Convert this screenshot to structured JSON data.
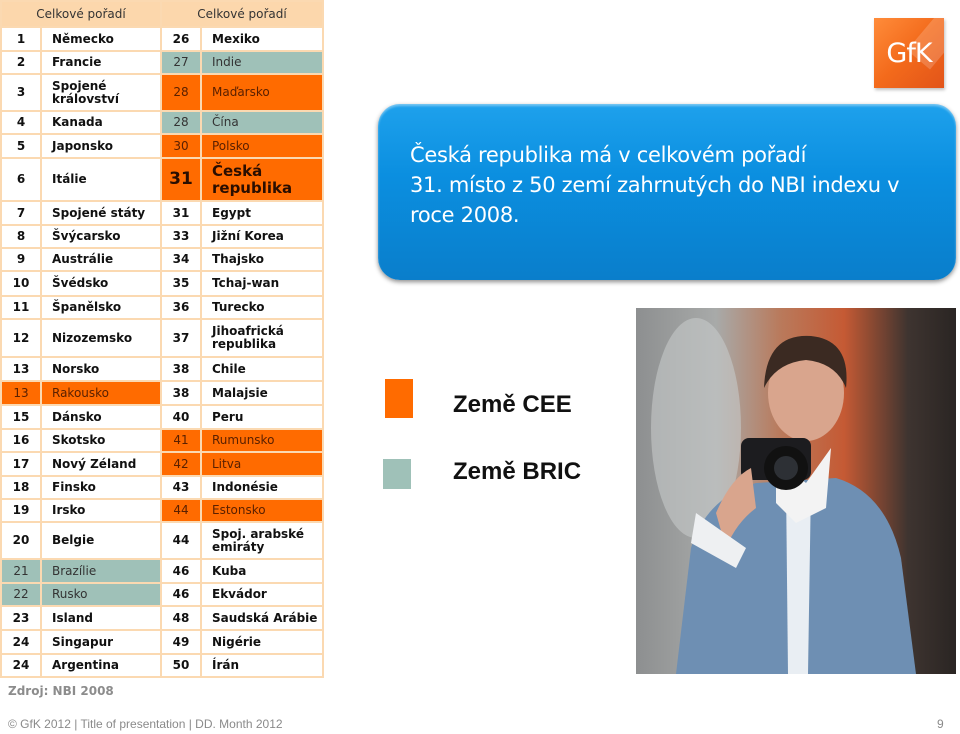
{
  "table": {
    "header_left": "Celkové pořadí",
    "header_right": "Celkové pořadí",
    "rows": [
      {
        "lr": "1",
        "ln": "Německo",
        "lc": "",
        "rr": "26",
        "rn": "Mexiko",
        "rc": ""
      },
      {
        "lr": "2",
        "ln": "Francie",
        "lc": "",
        "rr": "27",
        "rn": "Indie",
        "rc": "bric"
      },
      {
        "lr": "3",
        "ln": "Spojené království",
        "lc": "",
        "rr": "28",
        "rn": "Maďarsko",
        "rc": "cee"
      },
      {
        "lr": "4",
        "ln": "Kanada",
        "lc": "",
        "rr": "28",
        "rn": "Čína",
        "rc": "bric"
      },
      {
        "lr": "5",
        "ln": "Japonsko",
        "lc": "",
        "rr": "30",
        "rn": "Polsko",
        "rc": "cee"
      },
      {
        "lr": "6",
        "ln": "Itálie",
        "lc": "",
        "rr": "31",
        "rn": "Česká republika",
        "rc": "cee-highlight"
      },
      {
        "lr": "7",
        "ln": "Spojené státy",
        "lc": "",
        "rr": "31",
        "rn": "Egypt",
        "rc": ""
      },
      {
        "lr": "8",
        "ln": "Švýcarsko",
        "lc": "",
        "rr": "33",
        "rn": "Jižní Korea",
        "rc": ""
      },
      {
        "lr": "9",
        "ln": "Austrálie",
        "lc": "",
        "rr": "34",
        "rn": "Thajsko",
        "rc": ""
      },
      {
        "lr": "10",
        "ln": "Švédsko",
        "lc": "",
        "rr": "35",
        "rn": "Tchaj-wan",
        "rc": ""
      },
      {
        "lr": "11",
        "ln": "Španělsko",
        "lc": "",
        "rr": "36",
        "rn": "Turecko",
        "rc": ""
      },
      {
        "lr": "12",
        "ln": "Nizozemsko",
        "lc": "",
        "rr": "37",
        "rn": "Jihoafrická republika",
        "rc": ""
      },
      {
        "lr": "13",
        "ln": "Norsko",
        "lc": "",
        "rr": "38",
        "rn": "Chile",
        "rc": ""
      },
      {
        "lr": "13",
        "ln": "Rakousko",
        "lc": "cee",
        "rr": "38",
        "rn": "Malajsie",
        "rc": ""
      },
      {
        "lr": "15",
        "ln": "Dánsko",
        "lc": "",
        "rr": "40",
        "rn": "Peru",
        "rc": ""
      },
      {
        "lr": "16",
        "ln": "Skotsko",
        "lc": "",
        "rr": "41",
        "rn": "Rumunsko",
        "rc": "cee"
      },
      {
        "lr": "17",
        "ln": "Nový Zéland",
        "lc": "",
        "rr": "42",
        "rn": "Litva",
        "rc": "cee"
      },
      {
        "lr": "18",
        "ln": "Finsko",
        "lc": "",
        "rr": "43",
        "rn": "Indonésie",
        "rc": ""
      },
      {
        "lr": "19",
        "ln": "Irsko",
        "lc": "",
        "rr": "44",
        "rn": "Estonsko",
        "rc": "cee"
      },
      {
        "lr": "20",
        "ln": "Belgie",
        "lc": "",
        "rr": "44",
        "rn": "Spoj. arabské emiráty",
        "rc": ""
      },
      {
        "lr": "21",
        "ln": "Brazílie",
        "lc": "bric",
        "rr": "46",
        "rn": "Kuba",
        "rc": ""
      },
      {
        "lr": "22",
        "ln": "Rusko",
        "lc": "bric",
        "rr": "46",
        "rn": "Ekvádor",
        "rc": ""
      },
      {
        "lr": "23",
        "ln": "Island",
        "lc": "",
        "rr": "48",
        "rn": "Saudská Arábie",
        "rc": ""
      },
      {
        "lr": "24",
        "ln": "Singapur",
        "lc": "",
        "rr": "49",
        "rn": "Nigérie",
        "rc": ""
      },
      {
        "lr": "24",
        "ln": "Argentina",
        "lc": "",
        "rr": "50",
        "rn": "Írán",
        "rc": ""
      }
    ]
  },
  "source": "Zdroj: NBI 2008",
  "logo": {
    "text": "GfK",
    "icon": "gfk-logo-icon"
  },
  "callout": {
    "line1": "Česká republika má v celkovém pořadí",
    "line2": "31. místo z 50 zemí zahrnutých do NBI indexu v roce 2008."
  },
  "legend": {
    "cee": {
      "label": "Země CEE",
      "color": "#ff6b00"
    },
    "bric": {
      "label": "Země BRIC",
      "color": "#9fc1b8"
    }
  },
  "photo": {
    "description": "woman-with-camera-photo"
  },
  "footer": {
    "text": "© GfK 2012 | Title of presentation | DD. Month 2012",
    "page_number": "9"
  }
}
